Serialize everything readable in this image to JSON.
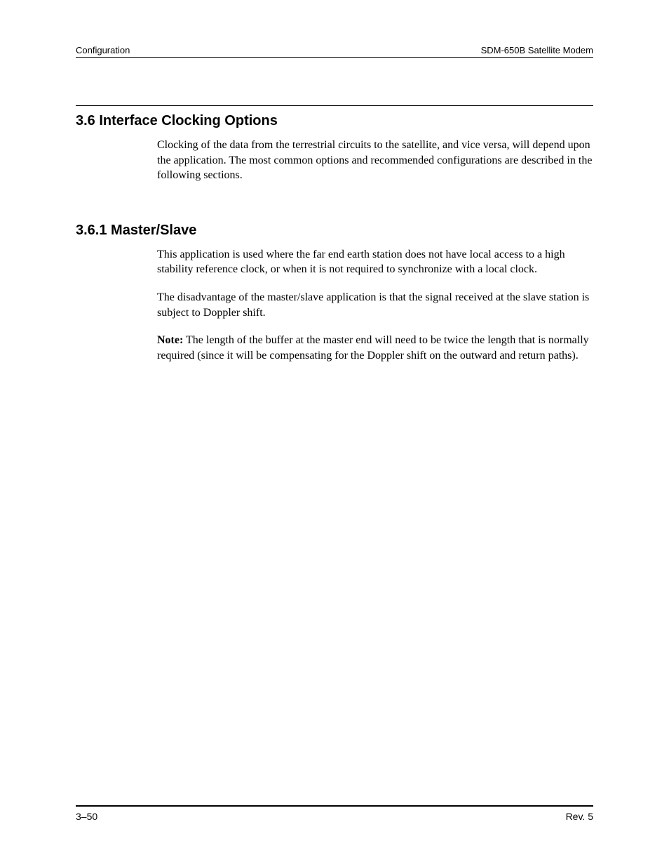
{
  "header": {
    "left": "Configuration",
    "right": "SDM-650B Satellite Modem"
  },
  "section": {
    "heading": "3.6  Interface Clocking Options",
    "paragraph1": "Clocking of the data from the terrestrial circuits to the satellite, and vice versa, will depend upon the application. The most common options and recommended configurations are described in the following sections."
  },
  "subsection": {
    "heading": "3.6.1  Master/Slave",
    "paragraph1": "This application is used where the far end earth station does not have local access to a high stability reference clock, or when it is not required to synchronize with a local clock.",
    "paragraph2": "The disadvantage of the master/slave application is that the signal received at the slave station is subject to Doppler shift.",
    "note_label": "Note:",
    "note_text": " The length of the buffer at the master end will need to be twice the length that is normally required (since it will be compensating for the Doppler shift on the outward and return paths)."
  },
  "footer": {
    "left": "3–50",
    "right": "Rev. 5"
  }
}
